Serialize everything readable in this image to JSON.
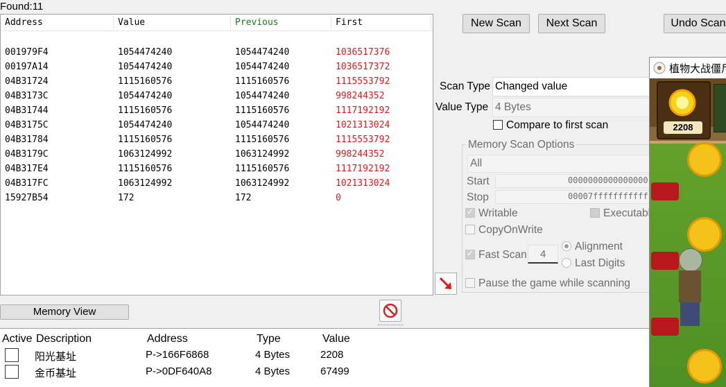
{
  "found": {
    "label": "Found:11"
  },
  "results": {
    "columns": [
      "Address",
      "Value",
      "Previous",
      "First"
    ],
    "rows": [
      [
        "001979F4",
        "1054474240",
        "1054474240",
        "1036517376"
      ],
      [
        "00197A14",
        "1054474240",
        "1054474240",
        "1036517372"
      ],
      [
        "04B31724",
        "1115160576",
        "1115160576",
        "1115553792"
      ],
      [
        "04B3173C",
        "1054474240",
        "1054474240",
        "998244352"
      ],
      [
        "04B31744",
        "1115160576",
        "1115160576",
        "1117192192"
      ],
      [
        "04B3175C",
        "1054474240",
        "1054474240",
        "1021313024"
      ],
      [
        "04B31784",
        "1115160576",
        "1115160576",
        "1115553792"
      ],
      [
        "04B3179C",
        "1063124992",
        "1063124992",
        "998244352"
      ],
      [
        "04B317E4",
        "1115160576",
        "1115160576",
        "1117192192"
      ],
      [
        "04B317FC",
        "1063124992",
        "1063124992",
        "1021313024"
      ],
      [
        "15927B54",
        "172",
        "172",
        "0"
      ]
    ]
  },
  "buttons": {
    "new_scan": "New Scan",
    "next_scan": "Next Scan",
    "undo_scan": "Undo Scan",
    "memory_view": "Memory View"
  },
  "scan": {
    "scan_type_label": "Scan Type",
    "scan_type_value": "Changed value",
    "value_type_label": "Value Type",
    "value_type_value": "4 Bytes",
    "compare_first": "Compare to first scan"
  },
  "memory_options": {
    "title": "Memory Scan Options",
    "region": "All",
    "start_label": "Start",
    "start_value": "0000000000000000",
    "stop_label": "Stop",
    "stop_value": "00007fffffffffff",
    "writable": "Writable",
    "executable": "Executable",
    "copy_on_write": "CopyOnWrite",
    "fast_scan": "Fast Scan",
    "fast_scan_value": "4",
    "alignment": "Alignment",
    "last_digits": "Last Digits",
    "pause_game": "Pause the game while scanning"
  },
  "address_list": {
    "columns": [
      "Active",
      "Description",
      "Address",
      "Type",
      "Value"
    ],
    "rows": [
      {
        "description": "阳光基址",
        "address": "P->166F6868",
        "type": "4 Bytes",
        "value": "2208"
      },
      {
        "description": "金币基址",
        "address": "P->0DF640A8",
        "type": "4 Bytes",
        "value": "67499"
      }
    ]
  },
  "game": {
    "title": "植物大战僵尸",
    "sun_count": "2208"
  },
  "colors": {
    "first_column": "#e8141a",
    "previous_header": "#128212"
  }
}
